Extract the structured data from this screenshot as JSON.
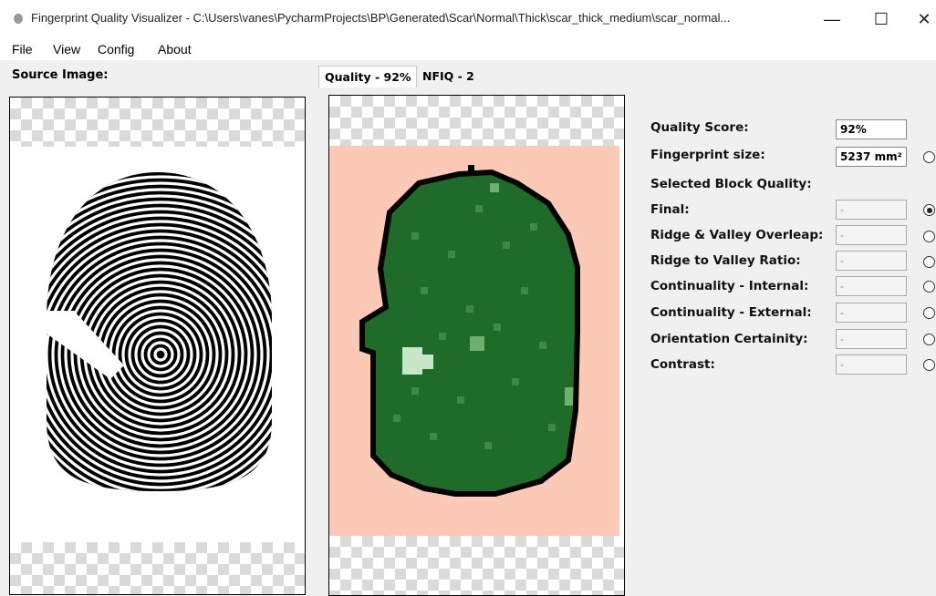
{
  "window": {
    "title": "Fingerprint Quality Visualizer - C:\\Users\\vanes\\PycharmProjects\\BP\\Generated\\Scar\\Normal\\Thick\\scar_thick_medium\\scar_normal...",
    "minimize_glyph": "—",
    "maximize_glyph": "☐",
    "close_glyph": "✕"
  },
  "menu": [
    "File",
    "View",
    "Config",
    "About"
  ],
  "source": {
    "label": "Source Image:"
  },
  "tabs": [
    {
      "label": "Quality - 92%",
      "active": true
    },
    {
      "label": "NFIQ - 2",
      "active": false
    }
  ],
  "quality": {
    "score_label": "Quality Score:",
    "score_value": "92%",
    "size_label": "Fingerprint size:",
    "size_value": "5237 mm²",
    "selected_block_label": "Selected Block Quality:",
    "metrics": [
      {
        "label": "Final:",
        "value": "-",
        "selected": true
      },
      {
        "label": "Ridge & Valley Overleap:",
        "value": "-",
        "selected": false
      },
      {
        "label": "Ridge to Valley Ratio:",
        "value": "-",
        "selected": false
      },
      {
        "label": "Continuality - Internal:",
        "value": "-",
        "selected": false
      },
      {
        "label": "Continuality - External:",
        "value": "-",
        "selected": false
      },
      {
        "label": "Orientation Certainity:",
        "value": "-",
        "selected": false
      },
      {
        "label": "Contrast:",
        "value": "-",
        "selected": false
      }
    ]
  },
  "colors": {
    "quality_background": "#fcc9b6",
    "block_dark": "#1f6b2a",
    "block_light": "#c8e6c8",
    "outline": "#000000"
  },
  "icons": {
    "app": "fingerprint-app-icon",
    "minimize": "minimize-icon",
    "maximize": "maximize-icon",
    "close": "close-icon"
  }
}
